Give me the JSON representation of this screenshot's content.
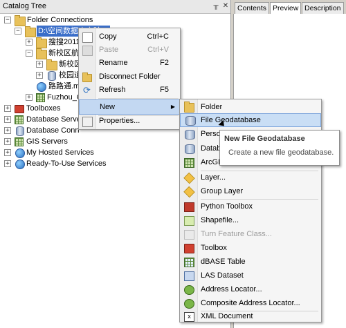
{
  "catalog": {
    "title": "Catalog Tree",
    "pin_icon": "pin-icon",
    "close_icon": "close-icon",
    "tree": [
      {
        "label": "Folder Connections",
        "expander": "−",
        "icon": "folder-connections-icon"
      },
      {
        "label": "D:\\空间数据库实验二",
        "expander": "−",
        "icon": "folder-icon",
        "selected": true
      },
      {
        "label": "搜搜2011",
        "expander": "+",
        "icon": "folder-icon"
      },
      {
        "label": "新校区航",
        "expander": "−",
        "icon": "folder-icon"
      },
      {
        "label": "新校区",
        "expander": "+",
        "icon": "folder-icon"
      },
      {
        "label": "校园道",
        "expander": "+",
        "icon": "geodatabase-icon"
      },
      {
        "label": "路路通.m",
        "expander": "",
        "icon": "map-document-icon"
      },
      {
        "label": "Fuzhou_C",
        "expander": "+",
        "icon": "raster-icon"
      },
      {
        "label": "Toolboxes",
        "expander": "+",
        "icon": "toolbox-icon"
      },
      {
        "label": "Database Serve",
        "expander": "+",
        "icon": "database-server-icon"
      },
      {
        "label": "Database Conn",
        "expander": "+",
        "icon": "database-connections-icon"
      },
      {
        "label": "GIS Servers",
        "expander": "+",
        "icon": "gis-servers-icon"
      },
      {
        "label": "My Hosted Services",
        "expander": "+",
        "icon": "hosted-services-icon"
      },
      {
        "label": "Ready-To-Use Services",
        "expander": "+",
        "icon": "ready-services-icon"
      }
    ]
  },
  "tabs": [
    {
      "label": "Contents",
      "active": false
    },
    {
      "label": "Preview",
      "active": true
    },
    {
      "label": "Description",
      "active": false
    }
  ],
  "context_menu": {
    "items": [
      {
        "label": "Copy",
        "shortcut": "Ctrl+C",
        "icon": "copy-icon",
        "disabled": false
      },
      {
        "label": "Paste",
        "shortcut": "Ctrl+V",
        "icon": "paste-icon",
        "disabled": true
      },
      {
        "label": "Rename",
        "shortcut": "F2",
        "icon": "",
        "disabled": false
      },
      {
        "label": "Disconnect Folder",
        "shortcut": "",
        "icon": "disconnect-folder-icon",
        "disabled": false
      },
      {
        "label": "Refresh",
        "shortcut": "F5",
        "icon": "refresh-icon",
        "disabled": false
      },
      {
        "label": "New",
        "shortcut": "",
        "icon": "",
        "disabled": false,
        "submenu": true,
        "arrow": "▶"
      },
      {
        "label": "Properties...",
        "shortcut": "",
        "icon": "properties-icon",
        "disabled": false
      }
    ]
  },
  "new_submenu": {
    "items": [
      {
        "label": "Folder",
        "icon": "folder-icon"
      },
      {
        "label": "File Geodatabase",
        "icon": "file-geodatabase-icon",
        "hot": true
      },
      {
        "label": "Perso",
        "icon": "personal-geodatabase-icon"
      },
      {
        "label": "Datab",
        "icon": "database-connection-icon"
      },
      {
        "label": "ArcGIS",
        "icon": "arcgis-server-icon"
      },
      {
        "label": "Layer...",
        "icon": "layer-icon"
      },
      {
        "label": "Group Layer",
        "icon": "group-layer-icon"
      },
      {
        "label": "Python Toolbox",
        "icon": "python-toolbox-icon"
      },
      {
        "label": "Shapefile...",
        "icon": "shapefile-icon"
      },
      {
        "label": "Turn Feature Class...",
        "icon": "turn-feature-class-icon",
        "disabled": true
      },
      {
        "label": "Toolbox",
        "icon": "toolbox-icon"
      },
      {
        "label": "dBASE Table",
        "icon": "dbase-table-icon"
      },
      {
        "label": "LAS Dataset",
        "icon": "las-dataset-icon"
      },
      {
        "label": "Address Locator...",
        "icon": "address-locator-icon"
      },
      {
        "label": "Composite Address Locator...",
        "icon": "composite-address-locator-icon"
      },
      {
        "label": "XML Document",
        "icon": "xml-document-icon"
      }
    ]
  },
  "tooltip": {
    "title": "New File Geodatabase",
    "body": "Create a new file geodatabase."
  }
}
